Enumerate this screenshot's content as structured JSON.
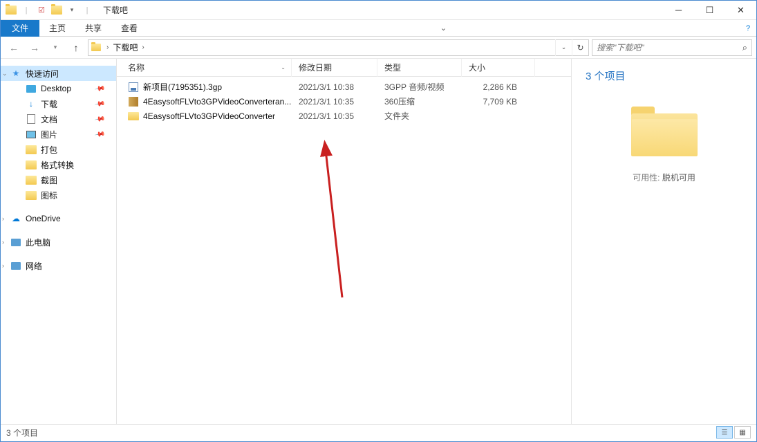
{
  "title": "下载吧",
  "ribbon": {
    "file": "文件",
    "tabs": [
      "主页",
      "共享",
      "查看"
    ]
  },
  "address": {
    "crumb": "下载吧",
    "search_placeholder": "搜索\"下载吧\""
  },
  "nav": {
    "quick_access": "快速访问",
    "items": [
      {
        "label": "Desktop",
        "pinned": true
      },
      {
        "label": "下载",
        "pinned": true
      },
      {
        "label": "文档",
        "pinned": true
      },
      {
        "label": "图片",
        "pinned": true
      },
      {
        "label": "打包",
        "pinned": false
      },
      {
        "label": "格式转换",
        "pinned": false
      },
      {
        "label": "截图",
        "pinned": false
      },
      {
        "label": "图标",
        "pinned": false
      }
    ],
    "onedrive": "OneDrive",
    "this_pc": "此电脑",
    "network": "网络"
  },
  "columns": {
    "name": "名称",
    "date": "修改日期",
    "type": "类型",
    "size": "大小"
  },
  "files": [
    {
      "name": "新项目(7195351).3gp",
      "date": "2021/3/1 10:38",
      "type": "3GPP 音频/视频",
      "size": "2,286 KB",
      "icon": "3gp"
    },
    {
      "name": "4EasysoftFLVto3GPVideoConverteran...",
      "date": "2021/3/1 10:35",
      "type": "360压缩",
      "size": "7,709 KB",
      "icon": "archive"
    },
    {
      "name": "4EasysoftFLVto3GPVideoConverter",
      "date": "2021/3/1 10:35",
      "type": "文件夹",
      "size": "",
      "icon": "folder"
    }
  ],
  "preview": {
    "title": "3 个项目",
    "availability_label": "可用性:",
    "availability_value": "脱机可用"
  },
  "status": {
    "text": "3 个项目"
  }
}
